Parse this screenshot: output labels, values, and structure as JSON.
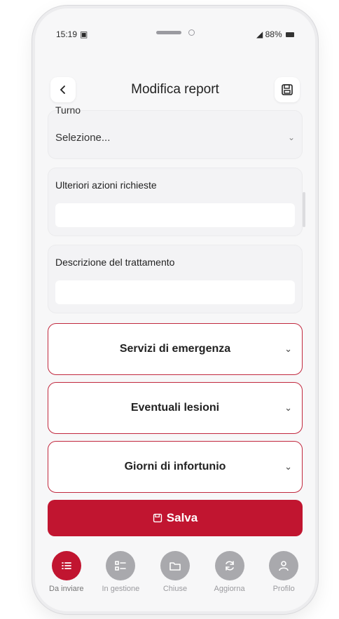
{
  "status_bar": {
    "time": "15:19",
    "battery": "88%"
  },
  "header": {
    "title": "Modifica report"
  },
  "form": {
    "field1": {
      "label_fragment": "Turno",
      "value": "Selezione..."
    },
    "field2": {
      "label": "Ulteriori azioni richieste",
      "value": ""
    },
    "field3": {
      "label": "Descrizione del trattamento",
      "value": ""
    }
  },
  "accordions": [
    {
      "label": "Servizi di emergenza"
    },
    {
      "label": "Eventuali lesioni"
    },
    {
      "label": "Giorni di infortunio"
    }
  ],
  "save_button": {
    "label": "Salva"
  },
  "tabs": [
    {
      "label": "Da inviare",
      "icon": "list-icon",
      "active": true
    },
    {
      "label": "In gestione",
      "icon": "checklist-icon",
      "active": false
    },
    {
      "label": "Chiuse",
      "icon": "folder-icon",
      "active": false
    },
    {
      "label": "Aggiorna",
      "icon": "refresh-icon",
      "active": false
    },
    {
      "label": "Profilo",
      "icon": "user-icon",
      "active": false
    }
  ],
  "colors": {
    "accent": "#c11530",
    "border_accent": "#c1283e",
    "inactive": "#a9a9ad"
  }
}
